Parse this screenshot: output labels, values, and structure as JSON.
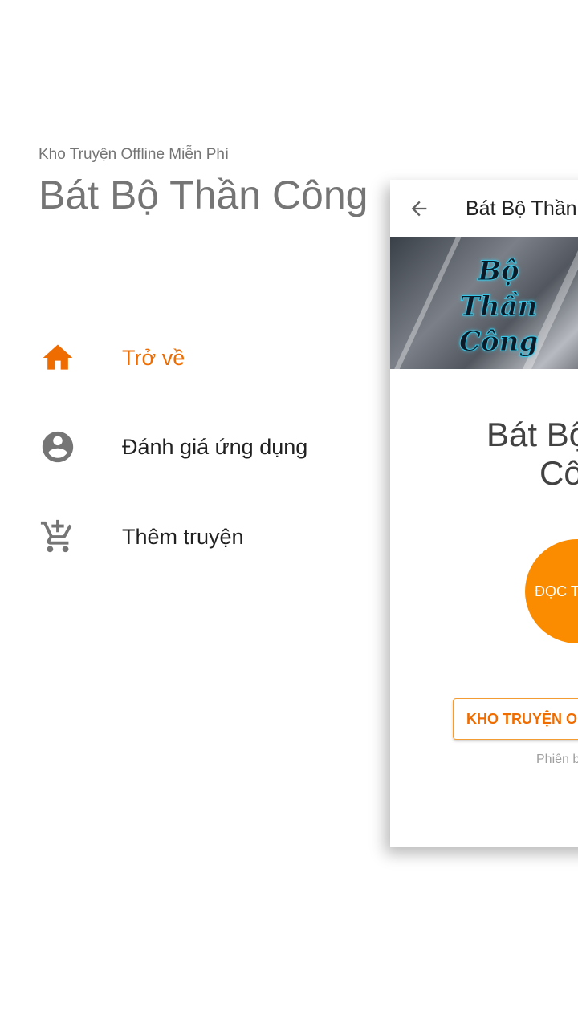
{
  "drawer": {
    "subtitle": "Kho Truyện Offline Miễn Phí",
    "title": "Bát Bộ Thần Công",
    "menu": [
      {
        "label": "Trở về",
        "icon": "home-icon",
        "active": true
      },
      {
        "label": "Đánh giá ứng dụng",
        "icon": "account-circle-icon",
        "active": false
      },
      {
        "label": "Thêm truyện",
        "icon": "add-shopping-cart-icon",
        "active": false
      }
    ]
  },
  "panel": {
    "toolbar_title": "Bát Bộ Thần",
    "cover_text": [
      "Bộ",
      "Thần",
      "Công"
    ],
    "book_title_line1": "Bát Bộ",
    "book_title_line2": "Cô",
    "read_button": "ĐỌC TI",
    "store_button": "KHO TRUYỆN OFF",
    "version": "Phiên b"
  },
  "colors": {
    "accent": "#ef6c00",
    "read_button_bg": "#fb8c00",
    "icon_gray": "#757575"
  }
}
